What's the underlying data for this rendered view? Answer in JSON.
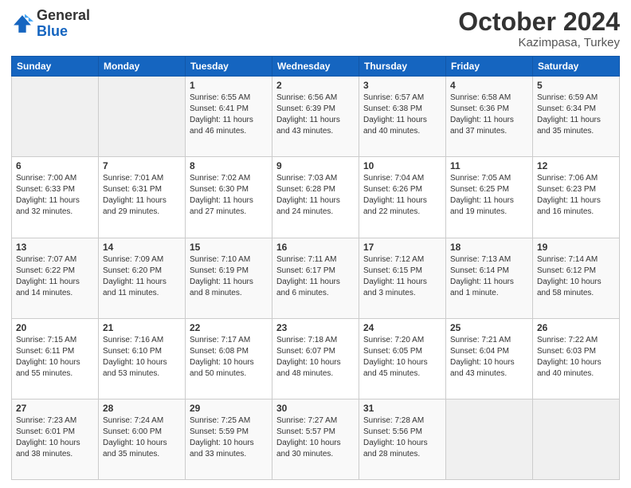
{
  "header": {
    "logo": {
      "general": "General",
      "blue": "Blue"
    },
    "title": "October 2024",
    "subtitle": "Kazimpasa, Turkey"
  },
  "weekdays": [
    "Sunday",
    "Monday",
    "Tuesday",
    "Wednesday",
    "Thursday",
    "Friday",
    "Saturday"
  ],
  "weeks": [
    [
      {
        "day": "",
        "sunrise": "",
        "sunset": "",
        "daylight": ""
      },
      {
        "day": "",
        "sunrise": "",
        "sunset": "",
        "daylight": ""
      },
      {
        "day": "1",
        "sunrise": "Sunrise: 6:55 AM",
        "sunset": "Sunset: 6:41 PM",
        "daylight": "Daylight: 11 hours and 46 minutes."
      },
      {
        "day": "2",
        "sunrise": "Sunrise: 6:56 AM",
        "sunset": "Sunset: 6:39 PM",
        "daylight": "Daylight: 11 hours and 43 minutes."
      },
      {
        "day": "3",
        "sunrise": "Sunrise: 6:57 AM",
        "sunset": "Sunset: 6:38 PM",
        "daylight": "Daylight: 11 hours and 40 minutes."
      },
      {
        "day": "4",
        "sunrise": "Sunrise: 6:58 AM",
        "sunset": "Sunset: 6:36 PM",
        "daylight": "Daylight: 11 hours and 37 minutes."
      },
      {
        "day": "5",
        "sunrise": "Sunrise: 6:59 AM",
        "sunset": "Sunset: 6:34 PM",
        "daylight": "Daylight: 11 hours and 35 minutes."
      }
    ],
    [
      {
        "day": "6",
        "sunrise": "Sunrise: 7:00 AM",
        "sunset": "Sunset: 6:33 PM",
        "daylight": "Daylight: 11 hours and 32 minutes."
      },
      {
        "day": "7",
        "sunrise": "Sunrise: 7:01 AM",
        "sunset": "Sunset: 6:31 PM",
        "daylight": "Daylight: 11 hours and 29 minutes."
      },
      {
        "day": "8",
        "sunrise": "Sunrise: 7:02 AM",
        "sunset": "Sunset: 6:30 PM",
        "daylight": "Daylight: 11 hours and 27 minutes."
      },
      {
        "day": "9",
        "sunrise": "Sunrise: 7:03 AM",
        "sunset": "Sunset: 6:28 PM",
        "daylight": "Daylight: 11 hours and 24 minutes."
      },
      {
        "day": "10",
        "sunrise": "Sunrise: 7:04 AM",
        "sunset": "Sunset: 6:26 PM",
        "daylight": "Daylight: 11 hours and 22 minutes."
      },
      {
        "day": "11",
        "sunrise": "Sunrise: 7:05 AM",
        "sunset": "Sunset: 6:25 PM",
        "daylight": "Daylight: 11 hours and 19 minutes."
      },
      {
        "day": "12",
        "sunrise": "Sunrise: 7:06 AM",
        "sunset": "Sunset: 6:23 PM",
        "daylight": "Daylight: 11 hours and 16 minutes."
      }
    ],
    [
      {
        "day": "13",
        "sunrise": "Sunrise: 7:07 AM",
        "sunset": "Sunset: 6:22 PM",
        "daylight": "Daylight: 11 hours and 14 minutes."
      },
      {
        "day": "14",
        "sunrise": "Sunrise: 7:09 AM",
        "sunset": "Sunset: 6:20 PM",
        "daylight": "Daylight: 11 hours and 11 minutes."
      },
      {
        "day": "15",
        "sunrise": "Sunrise: 7:10 AM",
        "sunset": "Sunset: 6:19 PM",
        "daylight": "Daylight: 11 hours and 8 minutes."
      },
      {
        "day": "16",
        "sunrise": "Sunrise: 7:11 AM",
        "sunset": "Sunset: 6:17 PM",
        "daylight": "Daylight: 11 hours and 6 minutes."
      },
      {
        "day": "17",
        "sunrise": "Sunrise: 7:12 AM",
        "sunset": "Sunset: 6:15 PM",
        "daylight": "Daylight: 11 hours and 3 minutes."
      },
      {
        "day": "18",
        "sunrise": "Sunrise: 7:13 AM",
        "sunset": "Sunset: 6:14 PM",
        "daylight": "Daylight: 11 hours and 1 minute."
      },
      {
        "day": "19",
        "sunrise": "Sunrise: 7:14 AM",
        "sunset": "Sunset: 6:12 PM",
        "daylight": "Daylight: 10 hours and 58 minutes."
      }
    ],
    [
      {
        "day": "20",
        "sunrise": "Sunrise: 7:15 AM",
        "sunset": "Sunset: 6:11 PM",
        "daylight": "Daylight: 10 hours and 55 minutes."
      },
      {
        "day": "21",
        "sunrise": "Sunrise: 7:16 AM",
        "sunset": "Sunset: 6:10 PM",
        "daylight": "Daylight: 10 hours and 53 minutes."
      },
      {
        "day": "22",
        "sunrise": "Sunrise: 7:17 AM",
        "sunset": "Sunset: 6:08 PM",
        "daylight": "Daylight: 10 hours and 50 minutes."
      },
      {
        "day": "23",
        "sunrise": "Sunrise: 7:18 AM",
        "sunset": "Sunset: 6:07 PM",
        "daylight": "Daylight: 10 hours and 48 minutes."
      },
      {
        "day": "24",
        "sunrise": "Sunrise: 7:20 AM",
        "sunset": "Sunset: 6:05 PM",
        "daylight": "Daylight: 10 hours and 45 minutes."
      },
      {
        "day": "25",
        "sunrise": "Sunrise: 7:21 AM",
        "sunset": "Sunset: 6:04 PM",
        "daylight": "Daylight: 10 hours and 43 minutes."
      },
      {
        "day": "26",
        "sunrise": "Sunrise: 7:22 AM",
        "sunset": "Sunset: 6:03 PM",
        "daylight": "Daylight: 10 hours and 40 minutes."
      }
    ],
    [
      {
        "day": "27",
        "sunrise": "Sunrise: 7:23 AM",
        "sunset": "Sunset: 6:01 PM",
        "daylight": "Daylight: 10 hours and 38 minutes."
      },
      {
        "day": "28",
        "sunrise": "Sunrise: 7:24 AM",
        "sunset": "Sunset: 6:00 PM",
        "daylight": "Daylight: 10 hours and 35 minutes."
      },
      {
        "day": "29",
        "sunrise": "Sunrise: 7:25 AM",
        "sunset": "Sunset: 5:59 PM",
        "daylight": "Daylight: 10 hours and 33 minutes."
      },
      {
        "day": "30",
        "sunrise": "Sunrise: 7:27 AM",
        "sunset": "Sunset: 5:57 PM",
        "daylight": "Daylight: 10 hours and 30 minutes."
      },
      {
        "day": "31",
        "sunrise": "Sunrise: 7:28 AM",
        "sunset": "Sunset: 5:56 PM",
        "daylight": "Daylight: 10 hours and 28 minutes."
      },
      {
        "day": "",
        "sunrise": "",
        "sunset": "",
        "daylight": ""
      },
      {
        "day": "",
        "sunrise": "",
        "sunset": "",
        "daylight": ""
      }
    ]
  ]
}
